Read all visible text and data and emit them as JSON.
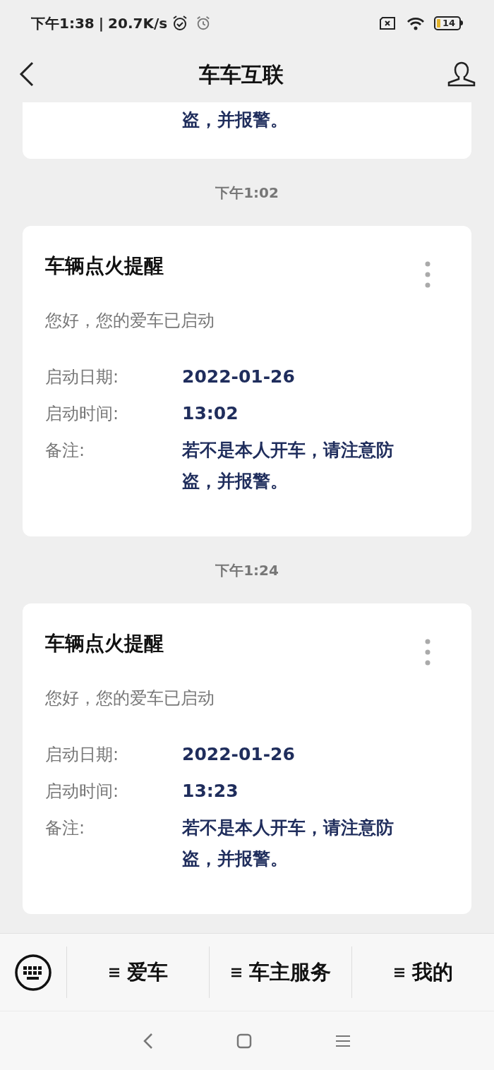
{
  "status_bar": {
    "time": "下午1:38",
    "separator": "|",
    "speed": "20.7K/s",
    "battery": "14"
  },
  "header": {
    "title": "车车互联"
  },
  "partial_card": {
    "note_tail": "盗，并报警。"
  },
  "messages": [
    {
      "time": "下午1:02",
      "title": "车辆点火提醒",
      "greeting": "您好，您的爱车已启动",
      "fields": [
        {
          "label": "启动日期:",
          "value": "2022-01-26"
        },
        {
          "label": "启动时间:",
          "value": "13:02"
        },
        {
          "label": "备注:",
          "value": "若不是本人开车，请注意防盗，并报警。"
        }
      ]
    },
    {
      "time": "下午1:24",
      "title": "车辆点火提醒",
      "greeting": "您好，您的爱车已启动",
      "fields": [
        {
          "label": "启动日期:",
          "value": "2022-01-26"
        },
        {
          "label": "启动时间:",
          "value": "13:23"
        },
        {
          "label": "备注:",
          "value": "若不是本人开车，请注意防盗，并报警。"
        }
      ]
    }
  ],
  "menu": [
    "爱车",
    "车主服务",
    "我的"
  ]
}
